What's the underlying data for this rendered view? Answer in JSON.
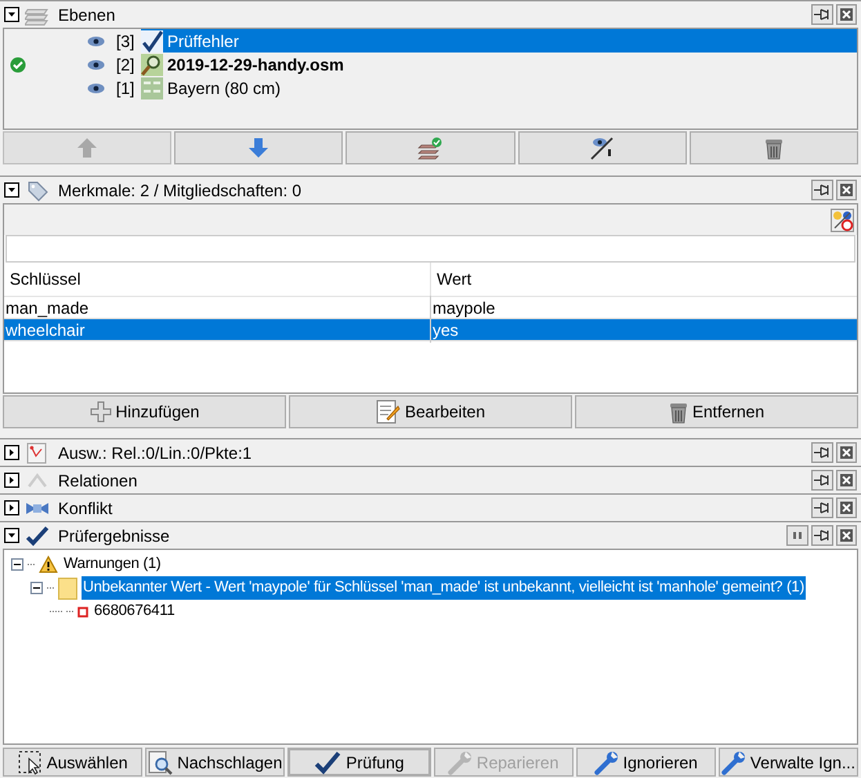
{
  "layers_panel": {
    "title": "Ebenen",
    "expanded": true,
    "layers": [
      {
        "index": "[3]",
        "name": "Prüffehler",
        "kind": "validator",
        "visible": true,
        "active": false,
        "selected": true
      },
      {
        "index": "[2]",
        "name": "2019-12-29-handy.osm",
        "kind": "data",
        "visible": true,
        "active": true,
        "selected": false
      },
      {
        "index": "[1]",
        "name": "Bayern (80 cm)",
        "kind": "imagery",
        "visible": true,
        "active": false,
        "selected": false
      }
    ],
    "buttons": [
      {
        "kind": "up",
        "disabled": true
      },
      {
        "kind": "down",
        "disabled": false
      },
      {
        "kind": "merge",
        "disabled": false
      },
      {
        "kind": "hide",
        "disabled": false
      },
      {
        "kind": "delete",
        "disabled": false
      }
    ]
  },
  "tags_panel": {
    "title": "Merkmale: 2 / Mitgliedschaften: 0",
    "expanded": true,
    "columns": [
      "Schlüssel",
      "Wert"
    ],
    "rows": [
      {
        "key": "man_made",
        "value": "maypole",
        "selected": false
      },
      {
        "key": "wheelchair",
        "value": "yes",
        "selected": true
      }
    ],
    "buttons": [
      {
        "label": "Hinzufügen",
        "kind": "add"
      },
      {
        "label": "Bearbeiten",
        "kind": "edit"
      },
      {
        "label": "Entfernen",
        "kind": "delete"
      }
    ]
  },
  "collapsed_panels": [
    {
      "title": "Ausw.: Rel.:0/Lin.:0/Pkte:1",
      "kind": "selection",
      "expanded": false
    },
    {
      "title": "Relationen",
      "kind": "relations",
      "expanded": false
    },
    {
      "title": "Konflikt",
      "kind": "conflict",
      "expanded": false
    }
  ],
  "validator_panel": {
    "title": "Prüfergebnisse",
    "expanded": true,
    "tree": [
      {
        "label": "Warnungen (1)",
        "kind": "warning",
        "expanded": true,
        "selected": false,
        "children": [
          {
            "label": "Unbekannter Wert - Wert 'maypole' für Schlüssel 'man_made' ist unbekannt, vielleicht ist 'manhole' gemeint? (1)",
            "kind": "folder",
            "expanded": true,
            "selected": true,
            "children": [
              {
                "label": "6680676411",
                "kind": "node",
                "selected": false
              }
            ]
          }
        ]
      }
    ],
    "buttons": [
      {
        "label": "Auswählen",
        "kind": "select",
        "focused": false,
        "disabled": false
      },
      {
        "label": "Nachschlagen",
        "kind": "lookup",
        "focused": false,
        "disabled": false
      },
      {
        "label": "Prüfung",
        "kind": "check",
        "focused": true,
        "disabled": false
      },
      {
        "label": "Reparieren",
        "kind": "wrench",
        "focused": false,
        "disabled": true
      },
      {
        "label": "Ignorieren",
        "kind": "wrench",
        "focused": false,
        "disabled": false
      },
      {
        "label": "Verwalte Ign...",
        "kind": "wrench",
        "focused": false,
        "disabled": false
      }
    ]
  }
}
